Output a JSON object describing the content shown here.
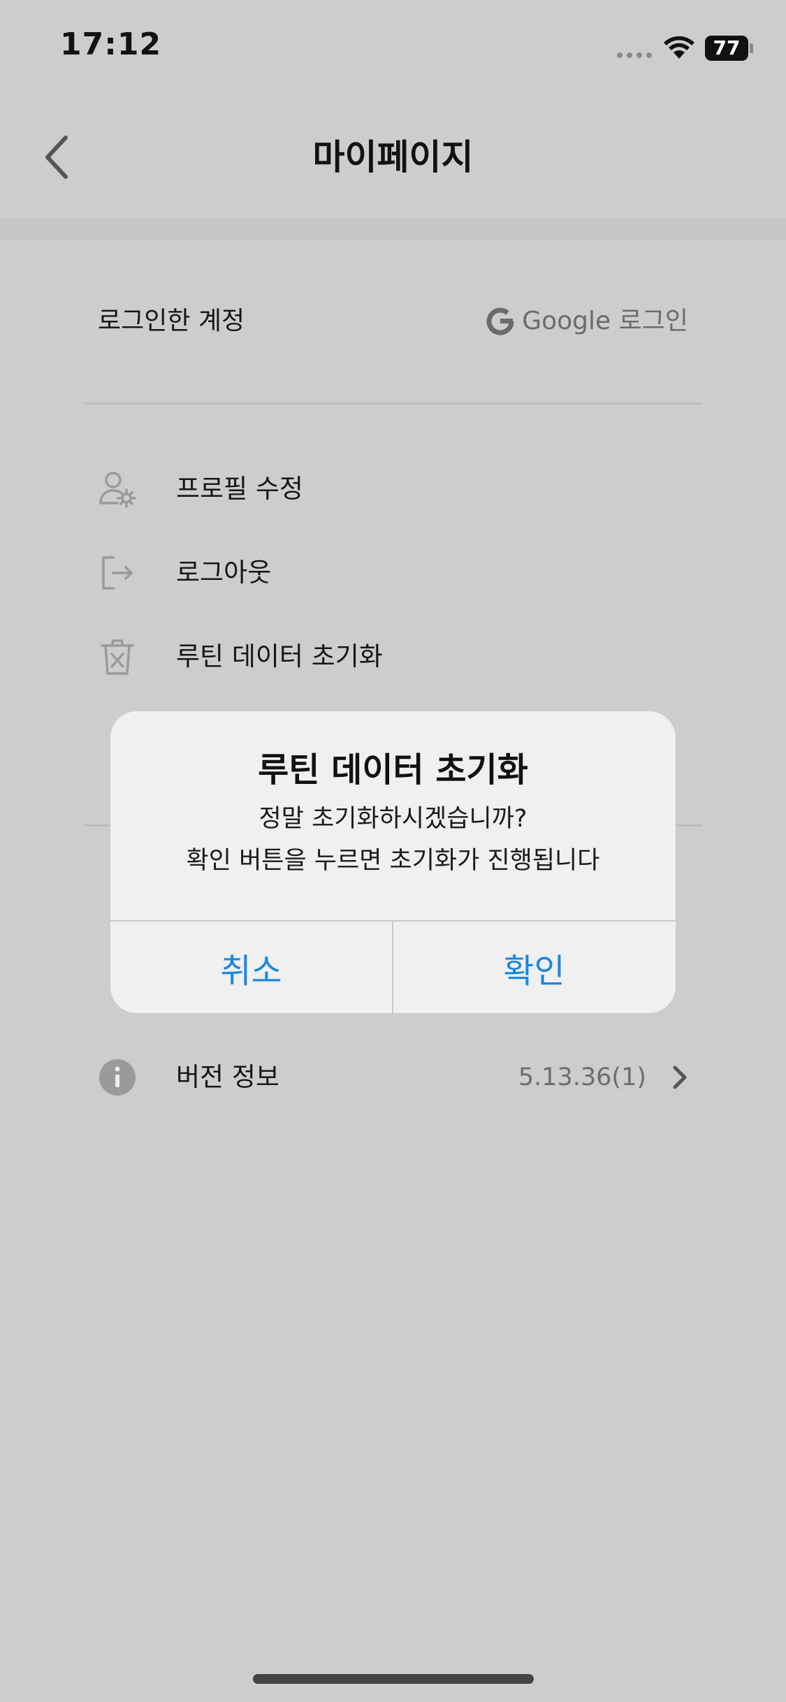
{
  "status_bar": {
    "time": "17:12",
    "battery": "77"
  },
  "header": {
    "title": "마이페이지",
    "back_icon": "chevron-left-icon"
  },
  "account": {
    "label": "로그인한 계정",
    "provider_icon": "google-icon",
    "value": "Google 로그인"
  },
  "menu": [
    {
      "label": "프로필 수정",
      "icon": "user-settings-icon"
    },
    {
      "label": "로그아웃",
      "icon": "logout-icon"
    },
    {
      "label": "루틴 데이터 초기화",
      "icon": "trash-icon"
    }
  ],
  "info_rows": [
    {
      "label": "버전 정보",
      "value": "5.13.36(1)",
      "icon": "info-icon"
    }
  ],
  "dialog": {
    "title": "루틴 데이터 초기화",
    "message_line1": "정말 초기화하시겠습니까?",
    "message_line2": "확인 버튼을 누르면 초기화가 진행됩니다",
    "cancel_label": "취소",
    "confirm_label": "확인"
  },
  "colors": {
    "background": "#cdcdcd",
    "dialog_background": "#f0f0f0",
    "accent": "#1a87e0"
  }
}
